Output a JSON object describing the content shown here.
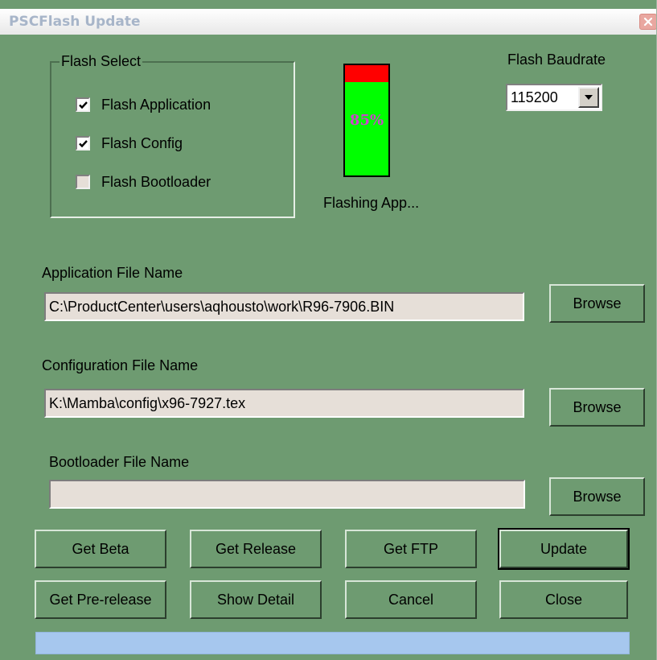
{
  "window": {
    "title": "PSCFlash Update"
  },
  "flash_select": {
    "legend": "Flash Select",
    "items": [
      {
        "label": "Flash Application",
        "checked": true
      },
      {
        "label": "Flash Config",
        "checked": true
      },
      {
        "label": "Flash Bootloader",
        "checked": false
      }
    ]
  },
  "progress": {
    "percent_label": "85%",
    "value": 0.85,
    "status": "Flashing App..."
  },
  "baudrate": {
    "label": "Flash Baudrate",
    "value": "115200"
  },
  "files": {
    "application": {
      "label": "Application File Name",
      "value": "C:\\ProductCenter\\users\\aqhousto\\work\\R96-7906.BIN",
      "browse": "Browse"
    },
    "configuration": {
      "label": "Configuration File Name",
      "value": "K:\\Mamba\\config\\x96-7927.tex",
      "browse": "Browse"
    },
    "bootloader": {
      "label": "Bootloader File Name",
      "value": "",
      "browse": "Browse"
    }
  },
  "buttons": {
    "get_beta": "Get Beta",
    "get_release": "Get Release",
    "get_ftp": "Get FTP",
    "update": "Update",
    "get_prerelease": "Get Pre-release",
    "show_detail": "Show Detail",
    "cancel": "Cancel",
    "close": "Close"
  },
  "colors": {
    "window_bg": "#6e9b71",
    "progress_fill": "#00ff00",
    "progress_remaining": "#ff0000",
    "percent_text": "#cc44cc",
    "bottom_bar": "#a6c7ee"
  },
  "icons": {
    "close": "close-icon",
    "dropdown": "chevron-down-icon",
    "check": "checkmark-icon"
  }
}
